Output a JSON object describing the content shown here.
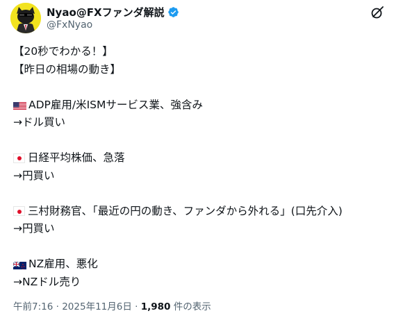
{
  "author": {
    "display_name": "Nyao@FXファンダ解説",
    "handle": "@FxNyao"
  },
  "post": {
    "lines": [
      {
        "text": "【20秒でわかる！】"
      },
      {
        "text": "【昨日の相場の動き】"
      },
      {
        "text": ""
      },
      {
        "flag": "us",
        "text": "ADP雇用/米ISMサービス業、強含み"
      },
      {
        "text": "→ドル買い"
      },
      {
        "text": ""
      },
      {
        "flag": "jp",
        "text": "日経平均株価、急落"
      },
      {
        "text": "→円買い"
      },
      {
        "text": ""
      },
      {
        "flag": "jp",
        "text": "三村財務官、「最近の円の動き、ファンダから外れる」(口先介入)"
      },
      {
        "text": "→円買い"
      },
      {
        "text": ""
      },
      {
        "flag": "nz",
        "text": "NZ雇用、悪化"
      },
      {
        "text": "→NZドル売り"
      }
    ]
  },
  "meta": {
    "time": "午前7:16",
    "separator": "·",
    "date": "2025年11月6日",
    "views_count": "1,980",
    "views_label": "件の表示"
  },
  "icons": {
    "verified": "verified-badge-icon",
    "grok": "grok-icon"
  },
  "colors": {
    "verified": "#1d9bf0",
    "secondary_text": "#536471",
    "avatar_bg": "#f2e31f"
  }
}
